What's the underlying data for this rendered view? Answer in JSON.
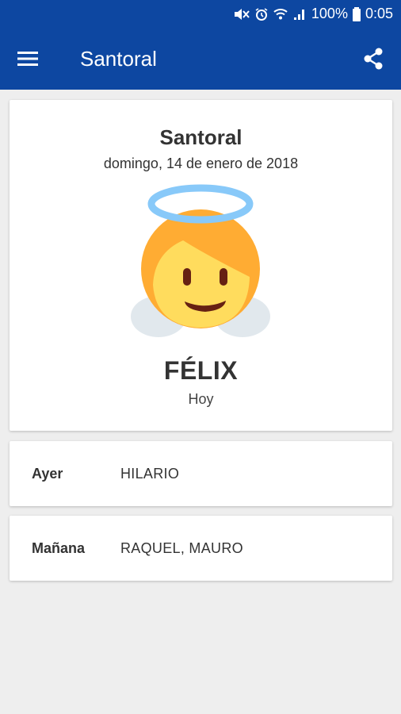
{
  "status_bar": {
    "battery": "100%",
    "time": "0:05",
    "icons": [
      "mute-icon",
      "alarm-icon",
      "wifi-icon",
      "signal-icon",
      "battery-icon"
    ]
  },
  "app_bar": {
    "title": "Santoral",
    "menu_icon": "menu-icon",
    "share_icon": "share-icon",
    "color": "#0d47a1"
  },
  "main_card": {
    "title": "Santoral",
    "date": "domingo, 14 de enero de 2018",
    "image": "angel-emoji",
    "saint": "FÉLIX",
    "subtitle": "Hoy"
  },
  "yesterday": {
    "label": "Ayer",
    "value": "HILARIO"
  },
  "tomorrow": {
    "label": "Mañana",
    "value": "RAQUEL, MAURO"
  }
}
